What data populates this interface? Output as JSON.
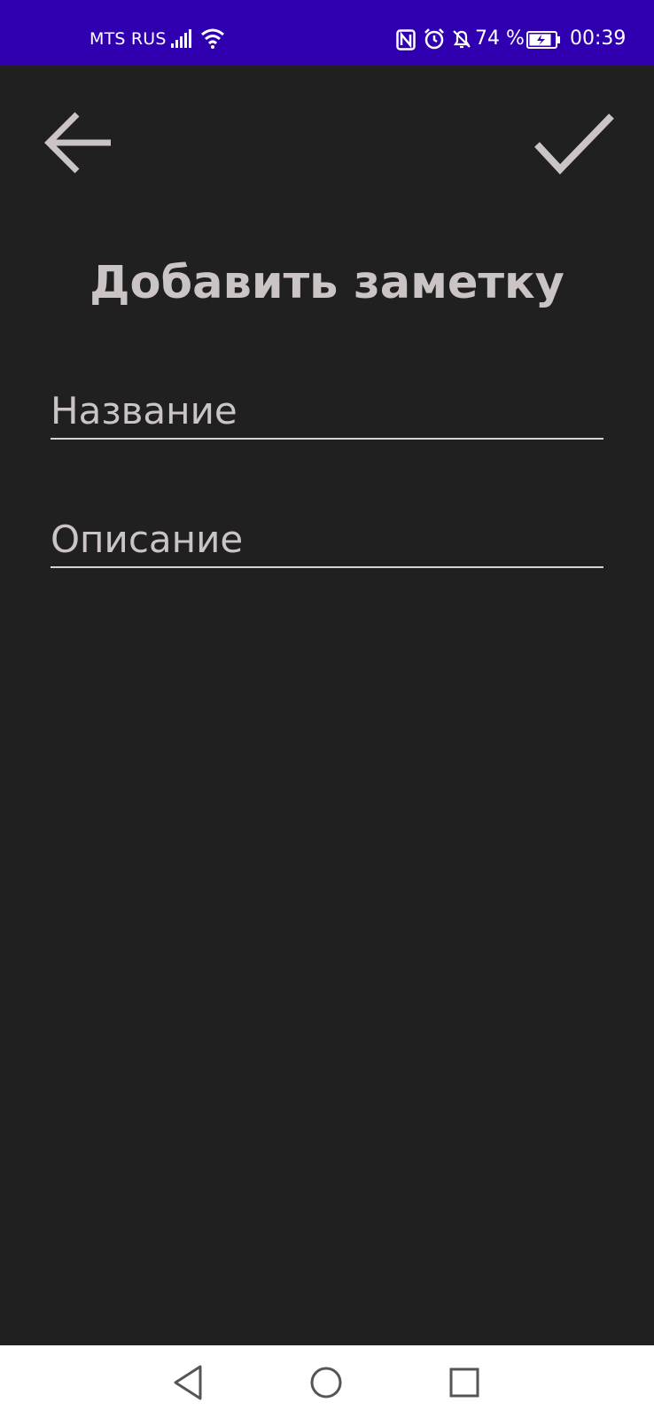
{
  "status_bar": {
    "carrier": "MTS RUS",
    "battery_percent": "74 %",
    "time": "00:39",
    "background_color": "#3000b0",
    "icons": [
      "signal-icon",
      "wifi-icon",
      "nfc-icon",
      "alarm-icon",
      "bell-off-icon",
      "battery-charging-icon"
    ]
  },
  "toolbar": {
    "back_icon": "arrow-left-icon",
    "confirm_icon": "checkmark-icon"
  },
  "page": {
    "title": "Добавить заметку",
    "background_color": "#202020",
    "text_color": "#cbc4c4"
  },
  "form": {
    "title_field": {
      "placeholder": "Название",
      "value": ""
    },
    "description_field": {
      "placeholder": "Описание",
      "value": ""
    }
  },
  "nav_bar": {
    "icons": [
      "triangle-back-icon",
      "circle-home-icon",
      "square-recents-icon"
    ]
  }
}
